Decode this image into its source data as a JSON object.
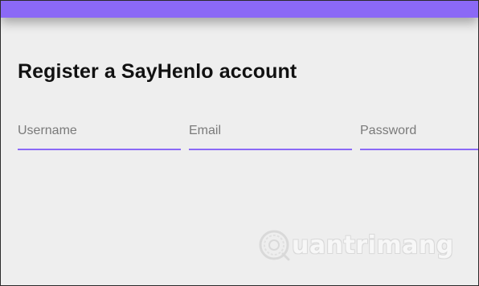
{
  "header": {
    "accent_color": "#8B69F6"
  },
  "form": {
    "title": "Register a SayHenlo account",
    "fields": [
      {
        "name": "username",
        "placeholder": "Username",
        "value": ""
      },
      {
        "name": "email",
        "placeholder": "Email",
        "value": ""
      },
      {
        "name": "password",
        "placeholder": "Password",
        "value": ""
      }
    ]
  },
  "watermark": {
    "text": "uantrimang",
    "icon": "quantrimang-logo-icon"
  }
}
